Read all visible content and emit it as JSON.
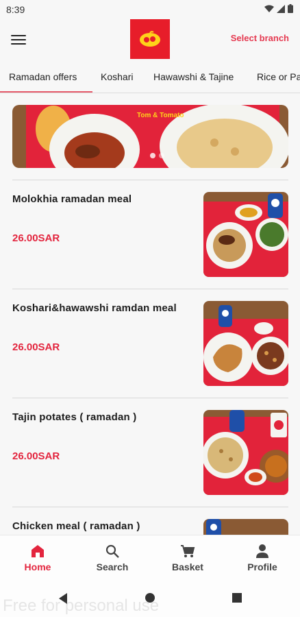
{
  "status_bar": {
    "time": "8:39"
  },
  "header": {
    "select_branch": "Select branch"
  },
  "tabs": [
    {
      "label": "Ramadan offers"
    },
    {
      "label": "Koshari"
    },
    {
      "label": "Hawawshi & Tajine"
    },
    {
      "label": "Rice or Pa"
    }
  ],
  "banner": {
    "text": "Tom & Tomato"
  },
  "menu_items": [
    {
      "name": "Molokhia ramadan meal",
      "price": "26.00SAR"
    },
    {
      "name": "Koshari&hawawshi ramdan meal",
      "price": "26.00SAR"
    },
    {
      "name": "Tajin potates ( ramadan )",
      "price": "26.00SAR"
    },
    {
      "name": "Chicken meal ( ramadan )",
      "price": ""
    }
  ],
  "bottom_nav": [
    {
      "label": "Home",
      "icon": "home-icon",
      "active": true
    },
    {
      "label": "Search",
      "icon": "search-icon",
      "active": false
    },
    {
      "label": "Basket",
      "icon": "cart-icon",
      "active": false
    },
    {
      "label": "Profile",
      "icon": "person-icon",
      "active": false
    }
  ],
  "watermark": "Free for personal use",
  "colors": {
    "accent": "#e3253e",
    "brand": "#e71d2a",
    "tab_underline": "#e65b6c"
  }
}
